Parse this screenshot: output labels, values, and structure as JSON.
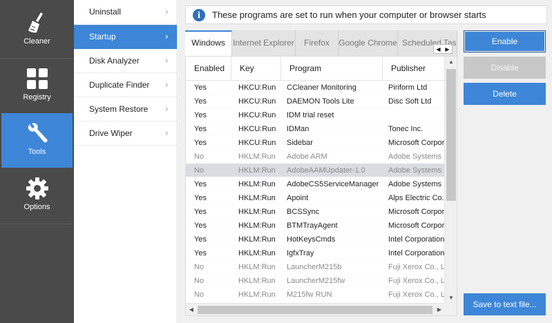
{
  "sidebar": {
    "items": [
      {
        "label": "Cleaner",
        "icon": "broom-icon"
      },
      {
        "label": "Registry",
        "icon": "grid-icon"
      },
      {
        "label": "Tools",
        "icon": "wrench-icon",
        "active": true
      },
      {
        "label": "Options",
        "icon": "gear-icon"
      }
    ]
  },
  "submenu": {
    "items": [
      {
        "label": "Uninstall"
      },
      {
        "label": "Startup",
        "active": true
      },
      {
        "label": "Disk Analyzer"
      },
      {
        "label": "Duplicate Finder"
      },
      {
        "label": "System Restore"
      },
      {
        "label": "Drive Wiper"
      }
    ]
  },
  "info": {
    "text": "These programs are set to run when your computer or browser starts"
  },
  "tabs": [
    "Windows",
    "Internet Explorer",
    "Firefox",
    "Google Chrome",
    "Scheduled Tasks"
  ],
  "table": {
    "headers": [
      "Enabled",
      "Key",
      "Program",
      "Publisher"
    ],
    "rows": [
      {
        "enabled": "Yes",
        "key": "HKCU:Run",
        "program": "CCleaner Monitoring",
        "publisher": "Piriform Ltd",
        "state": "on"
      },
      {
        "enabled": "Yes",
        "key": "HKCU:Run",
        "program": "DAEMON Tools Lite",
        "publisher": "Disc Soft Ltd",
        "state": "on"
      },
      {
        "enabled": "Yes",
        "key": "HKCU:Run",
        "program": "IDM trial reset",
        "publisher": "",
        "state": "on"
      },
      {
        "enabled": "Yes",
        "key": "HKCU:Run",
        "program": "IDMan",
        "publisher": "Tonec Inc.",
        "state": "on"
      },
      {
        "enabled": "Yes",
        "key": "HKCU:Run",
        "program": "Sidebar",
        "publisher": "Microsoft Corporation",
        "state": "on"
      },
      {
        "enabled": "No",
        "key": "HKLM:Run",
        "program": "Adobe ARM",
        "publisher": "Adobe Systems Incorporated",
        "state": "off"
      },
      {
        "enabled": "No",
        "key": "HKLM:Run",
        "program": "AdobeAAMUpdater-1.0",
        "publisher": "Adobe Systems Incorporated",
        "state": "selected"
      },
      {
        "enabled": "Yes",
        "key": "HKLM:Run",
        "program": "AdobeCS5ServiceManager",
        "publisher": "Adobe Systems Incorporated",
        "state": "on"
      },
      {
        "enabled": "Yes",
        "key": "HKLM:Run",
        "program": "Apoint",
        "publisher": "Alps Electric Co., Ltd.",
        "state": "on"
      },
      {
        "enabled": "Yes",
        "key": "HKLM:Run",
        "program": "BCSSync",
        "publisher": "Microsoft Corporation",
        "state": "on"
      },
      {
        "enabled": "Yes",
        "key": "HKLM:Run",
        "program": "BTMTrayAgent",
        "publisher": "Microsoft Corporation",
        "state": "on"
      },
      {
        "enabled": "Yes",
        "key": "HKLM:Run",
        "program": "HotKeysCmds",
        "publisher": "Intel Corporation",
        "state": "on"
      },
      {
        "enabled": "Yes",
        "key": "HKLM:Run",
        "program": "IgfxTray",
        "publisher": "Intel Corporation",
        "state": "on"
      },
      {
        "enabled": "No",
        "key": "HKLM:Run",
        "program": "LauncherM215b",
        "publisher": "Fuji Xerox Co., Ltd.",
        "state": "off"
      },
      {
        "enabled": "No",
        "key": "HKLM:Run",
        "program": "LauncherM215fw",
        "publisher": "Fuji Xerox Co., Ltd.",
        "state": "off"
      },
      {
        "enabled": "No",
        "key": "HKLM:Run",
        "program": "M215fw RUN",
        "publisher": "Fuji Xerox Co., Ltd.",
        "state": "off"
      }
    ]
  },
  "buttons": {
    "enable": "Enable",
    "disable": "Disable",
    "delete": "Delete",
    "save": "Save to text file..."
  },
  "colors": {
    "accent": "#3d86d8",
    "sidebar": "#4a4a4a"
  }
}
